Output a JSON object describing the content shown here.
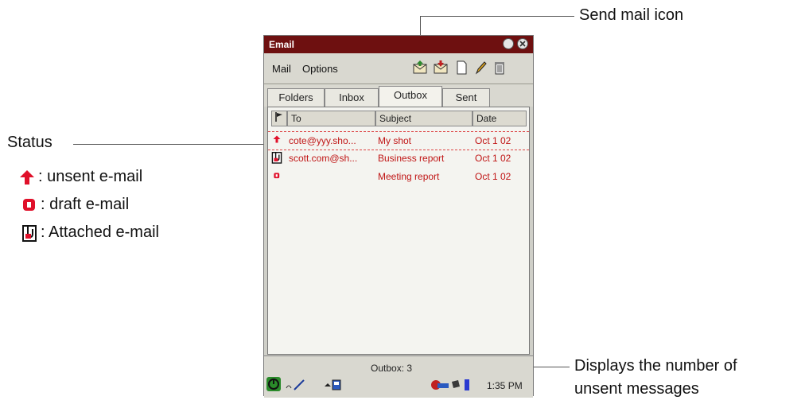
{
  "annotations": {
    "send_mail": "Send mail icon",
    "status": "Status",
    "displays_line1": "Displays the number of",
    "displays_line2": "unsent messages",
    "legend": [
      {
        "icon": "unsent-arrow-icon",
        "label": ": unsent e-mail"
      },
      {
        "icon": "draft-icon",
        "label": ": draft e-mail"
      },
      {
        "icon": "attachment-icon",
        "label": ": Attached e-mail"
      }
    ]
  },
  "window": {
    "title": "Email"
  },
  "menu": {
    "mail": "Mail",
    "options": "Options"
  },
  "tabs": [
    "Folders",
    "Inbox",
    "Outbox",
    "Sent"
  ],
  "columns": {
    "to": "To",
    "subject": "Subject",
    "date": "Date"
  },
  "rows": [
    {
      "status": "unsent",
      "to": "cote@yyy.sho...",
      "subject": "My shot",
      "date": "Oct 1 02"
    },
    {
      "status": "attached",
      "to": "scott.com@sh...",
      "subject": "Business report",
      "date": "Oct 1 02"
    },
    {
      "status": "draft",
      "to": "",
      "subject": "Meeting report",
      "date": "Oct 1 02"
    }
  ],
  "statusbar": {
    "count_label": "Outbox: 3",
    "time": "1:35 PM"
  },
  "colors": {
    "titlebar": "#6e1010",
    "row_text": "#c01515",
    "accent_red": "#e0102a"
  }
}
